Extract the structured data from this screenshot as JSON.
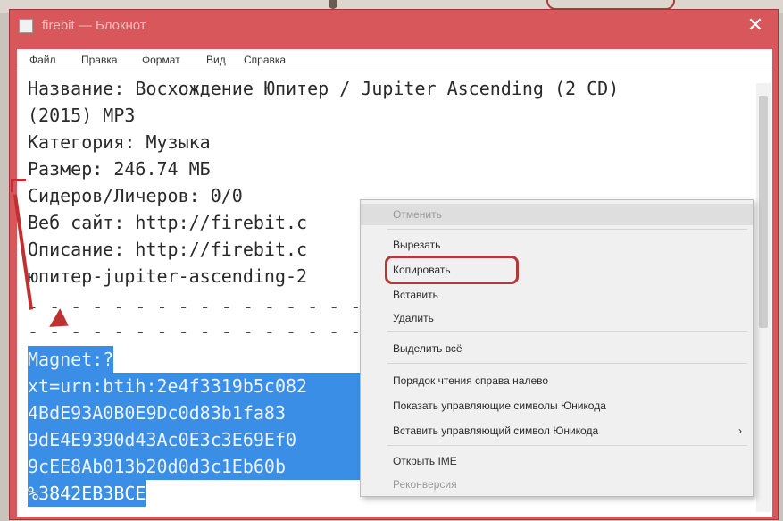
{
  "window": {
    "title": "firebit — Блокнот",
    "close_glyph": "✕"
  },
  "menubar": {
    "items": [
      "Файл",
      "Правка",
      "Формат",
      "Вид",
      "Справка"
    ]
  },
  "editor": {
    "lines": [
      "Название: Восхождение Юпитер / Jupiter Ascending (2 CD)",
      "(2015) MP3",
      "Категория: Музыка",
      "Размер: 246.74 МБ",
      "Сидеров/Личеров: 0/0",
      "Веб сайт: http://firebit.c",
      "Описание: http://firebit.c",
      "юпитер-jupiter-ascending-2",
      "- - - - - - - - - - - - - - - - - - - - - -",
      "- - - - - - - - - - - - - - - - - - - - - -"
    ],
    "selected_lines": [
      "Magnet:?",
      "xt=urn:btih:2e4f3319b5c082",
      "4BdE93A0B0E9Dc0d83b1fa83",
      "9dE4E9390d43Ac0E3c3E69Ef0",
      "9cEE8Ab013b20d0d3c1Eb60b",
      "%3842EB3BCE"
    ]
  },
  "context_menu": {
    "items": [
      {
        "label": "Отменить",
        "disabled": true,
        "hover": true
      },
      {
        "label": "Вырезать",
        "disabled": false
      },
      {
        "label": "Копировать",
        "disabled": false
      },
      {
        "label": "Вставить",
        "disabled": false
      },
      {
        "label": "Удалить",
        "disabled": false
      },
      {
        "label": "Выделить всё",
        "disabled": false
      },
      {
        "label": "Порядок чтения справа налево",
        "disabled": false
      },
      {
        "label": "Показать управляющие символы Юникода",
        "disabled": false
      },
      {
        "label": "Вставить управляющий символ Юникода",
        "disabled": false,
        "submenu": "›"
      },
      {
        "label": "Открыть IME",
        "disabled": false
      },
      {
        "label": "Реконверсия",
        "disabled": true
      }
    ]
  },
  "colors": {
    "title_bar": "#d8575a",
    "selection": "#3a8ee6",
    "annotation": "#c03030"
  }
}
